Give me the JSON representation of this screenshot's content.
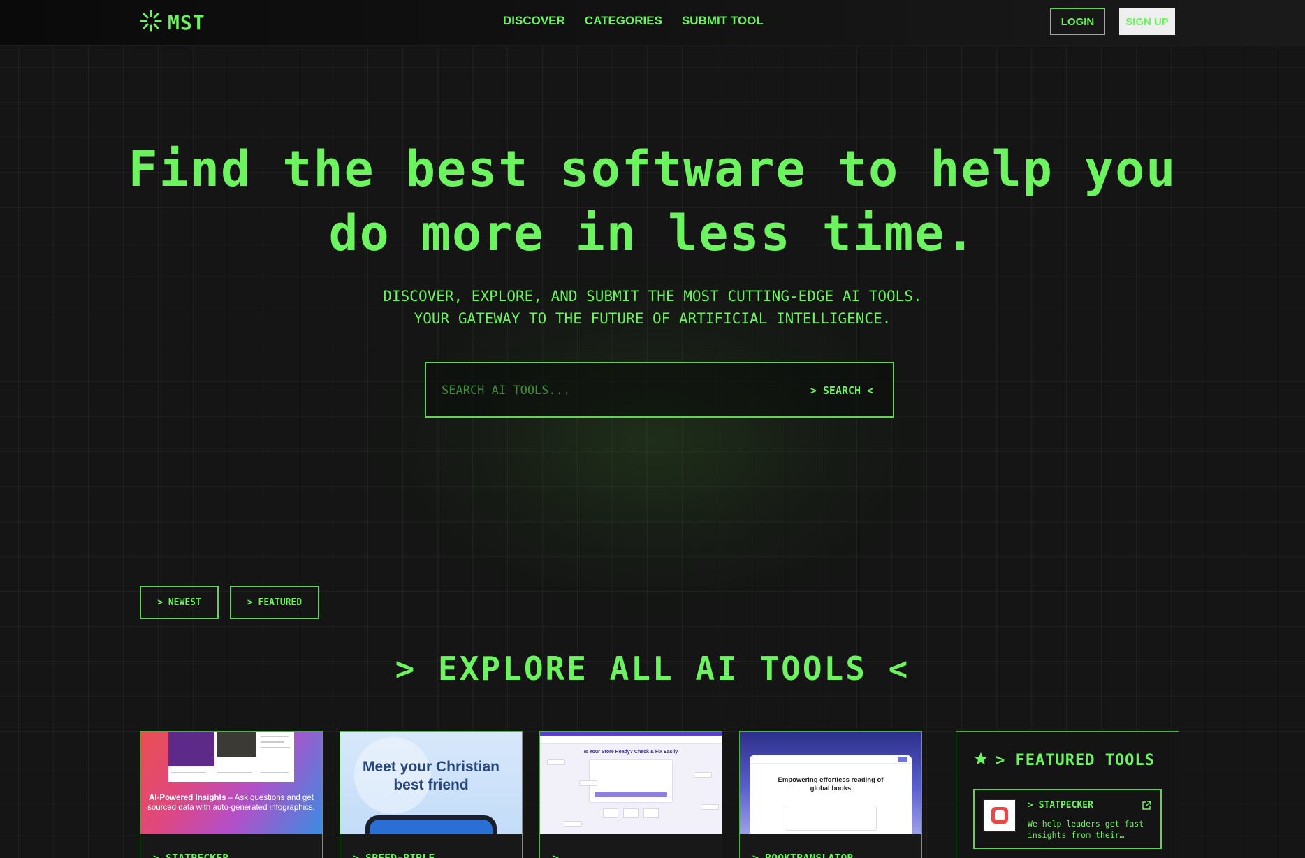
{
  "nav": {
    "brand": "MST",
    "links": [
      "DISCOVER",
      "CATEGORIES",
      "SUBMIT TOOL"
    ],
    "login_label": "LOGIN",
    "signup_label": "SIGN UP"
  },
  "hero": {
    "title_line1": "Find the best software to help you",
    "title_line2": "do more in less time.",
    "subtitle_line1": "DISCOVER, EXPLORE, AND SUBMIT THE MOST CUTTING-EDGE AI TOOLS.",
    "subtitle_line2": "YOUR GATEWAY TO THE FUTURE OF ARTIFICIAL INTELLIGENCE.",
    "search_placeholder": "SEARCH AI TOOLS...",
    "search_button": "> SEARCH <"
  },
  "filters": {
    "newest": "> NEWEST",
    "featured": "> FEATURED"
  },
  "explore": {
    "title": "> EXPLORE ALL AI TOOLS <"
  },
  "cards": [
    {
      "name": "> STATPECKER",
      "thumb_caption_bold": "AI-Powered Insights",
      "thumb_caption_rest": " – Ask questions and get sourced data with auto-generated infographics."
    },
    {
      "name": "> SPEED-BIBLE",
      "thumb_headline_line1": "Meet your Christian",
      "thumb_headline_line2": "best friend"
    },
    {
      "name": ">",
      "thumb_heading": "Is Your Store Ready? Check & Fix Easily"
    },
    {
      "name": "> BOOKTRANSLATOR",
      "thumb_title_line1": "Empowering effortless reading of",
      "thumb_title_line2": "global books"
    }
  ],
  "featured_panel": {
    "title": "> FEATURED TOOLS",
    "items": [
      {
        "name": "> STATPECKER",
        "description": "We help leaders get fast insights from their…"
      }
    ]
  },
  "icons": {
    "logo": "sparkle-burst-icon",
    "featured": "star-icon",
    "external": "external-link-icon"
  },
  "colors": {
    "accent": "#6cf35f",
    "background": "#141514"
  }
}
